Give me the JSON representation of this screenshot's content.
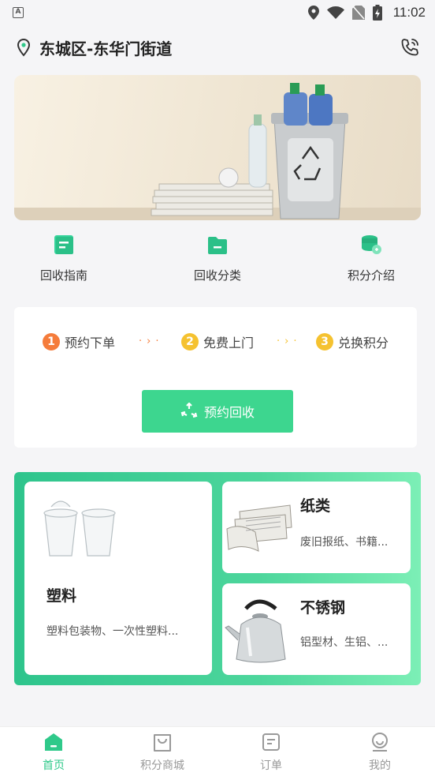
{
  "status_bar": {
    "time": "11:02",
    "left_icon": "A"
  },
  "header": {
    "location": "东城区-东华门街道"
  },
  "quick_nav": [
    {
      "label": "回收指南",
      "icon": "guide-icon"
    },
    {
      "label": "回收分类",
      "icon": "folder-icon"
    },
    {
      "label": "积分介绍",
      "icon": "coin-icon"
    }
  ],
  "steps": [
    {
      "num": "1",
      "label": "预约下单",
      "color": "#f57c3b"
    },
    {
      "num": "2",
      "label": "免费上门",
      "color": "#f5c230"
    },
    {
      "num": "3",
      "label": "兑换积分",
      "color": "#f5c230"
    }
  ],
  "book_button": {
    "label": "预约回收"
  },
  "categories": [
    {
      "title": "塑料",
      "desc": "塑料包装物、一次性塑料..."
    },
    {
      "title": "纸类",
      "desc": "废旧报纸、书籍..."
    },
    {
      "title": "不锈钢",
      "desc": "铝型材、生铝、..."
    }
  ],
  "tabs": [
    {
      "label": "首页",
      "active": true
    },
    {
      "label": "积分商城",
      "active": false
    },
    {
      "label": "订单",
      "active": false
    },
    {
      "label": "我的",
      "active": false
    }
  ],
  "colors": {
    "accent": "#2fc98a",
    "button": "#3dd68f"
  }
}
